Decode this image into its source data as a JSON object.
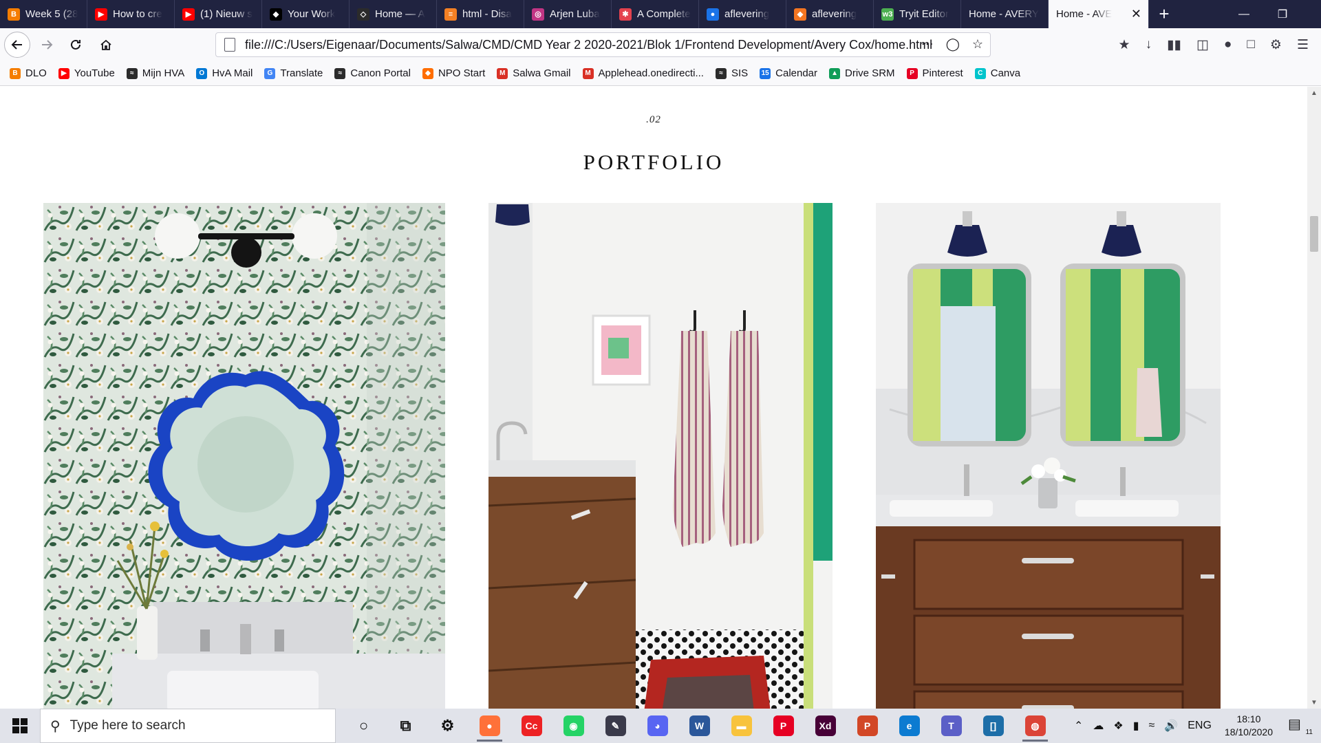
{
  "browser": {
    "tabs": [
      {
        "label": "Week 5 (28",
        "icon": "blogger-icon",
        "color": "#f57d00",
        "glyph": "B"
      },
      {
        "label": "How to cre",
        "icon": "youtube-icon",
        "color": "#ff0000",
        "glyph": "▶"
      },
      {
        "label": "(1) Nieuw s",
        "icon": "youtube-icon",
        "color": "#ff0000",
        "glyph": "▶"
      },
      {
        "label": "Your Work",
        "icon": "codepen-icon",
        "color": "#000000",
        "glyph": "◆"
      },
      {
        "label": "Home — A",
        "icon": "codepen-icon",
        "color": "#2b2b2b",
        "glyph": "◇"
      },
      {
        "label": "html - Disa",
        "icon": "stackoverflow-icon",
        "color": "#f48024",
        "glyph": "≡"
      },
      {
        "label": "Arjen Luba",
        "icon": "instagram-icon",
        "color": "#c13584",
        "glyph": "◎"
      },
      {
        "label": "A Complete",
        "icon": "css-tricks-icon",
        "color": "#e4424e",
        "glyph": "✱"
      },
      {
        "label": "aflevering",
        "icon": "video-icon",
        "color": "#1a73e8",
        "glyph": "●"
      },
      {
        "label": "aflevering",
        "icon": "crunchyroll-icon",
        "color": "#f47521",
        "glyph": "◆"
      },
      {
        "label": "Tryit Editor",
        "icon": "w3schools-icon",
        "color": "#4caf50",
        "glyph": "w3"
      },
      {
        "label": "Home - AVERY",
        "icon": "",
        "color": "",
        "glyph": ""
      }
    ],
    "active_tab": {
      "label": "Home - AVE"
    },
    "new_tab": "+",
    "url": "file:///C:/Users/Eigenaar/Documents/Salwa/CMD/CMD Year 2 2020-2021/Blok 1/Frontend Development/Avery Cox/home.html",
    "bookmarks": [
      {
        "label": "DLO",
        "color": "#f57d00",
        "glyph": "B"
      },
      {
        "label": "YouTube",
        "color": "#ff0000",
        "glyph": "▶"
      },
      {
        "label": "Mijn HVA",
        "color": "#2b2b2b",
        "glyph": "≈"
      },
      {
        "label": "HvA Mail",
        "color": "#0078d4",
        "glyph": "O"
      },
      {
        "label": "Translate",
        "color": "#4285f4",
        "glyph": "G"
      },
      {
        "label": "Canon Portal",
        "color": "#2b2b2b",
        "glyph": "≈"
      },
      {
        "label": "NPO Start",
        "color": "#ff6d00",
        "glyph": "◆"
      },
      {
        "label": "Salwa Gmail",
        "color": "#d93025",
        "glyph": "M"
      },
      {
        "label": "Applehead.onedirecti...",
        "color": "#d93025",
        "glyph": "M"
      },
      {
        "label": "SIS",
        "color": "#2b2b2b",
        "glyph": "≈"
      },
      {
        "label": "Calendar",
        "color": "#1a73e8",
        "glyph": "15"
      },
      {
        "label": "Drive SRM",
        "color": "#0f9d58",
        "glyph": "▲"
      },
      {
        "label": "Pinterest",
        "color": "#e60023",
        "glyph": "P"
      },
      {
        "label": "Canva",
        "color": "#00c4cc",
        "glyph": "C"
      }
    ]
  },
  "page": {
    "section_number": ".02",
    "section_title": "PORTFOLIO"
  },
  "taskbar": {
    "search_placeholder": "Type here to search",
    "apps": [
      {
        "name": "cortana-icon",
        "color": "transparent",
        "glyph": "○",
        "running": false
      },
      {
        "name": "task-view-icon",
        "color": "transparent",
        "glyph": "⧉",
        "running": false
      },
      {
        "name": "settings-icon",
        "color": "transparent",
        "glyph": "⚙",
        "running": false
      },
      {
        "name": "firefox-icon",
        "color": "#ff7139",
        "glyph": "●",
        "running": true
      },
      {
        "name": "creative-cloud-icon",
        "color": "#ed2224",
        "glyph": "Cc",
        "running": false
      },
      {
        "name": "whatsapp-icon",
        "color": "#25d366",
        "glyph": "◉",
        "running": false
      },
      {
        "name": "pen-app-icon",
        "color": "#3a3a4a",
        "glyph": "✎",
        "running": false
      },
      {
        "name": "discord-icon",
        "color": "#5865f2",
        "glyph": "◕",
        "running": false
      },
      {
        "name": "word-icon",
        "color": "#2b579a",
        "glyph": "W",
        "running": false
      },
      {
        "name": "file-explorer-icon",
        "color": "#f8c33c",
        "glyph": "▬",
        "running": false
      },
      {
        "name": "pinterest-icon",
        "color": "#e60023",
        "glyph": "P",
        "running": false
      },
      {
        "name": "adobe-xd-icon",
        "color": "#470137",
        "glyph": "Xd",
        "running": false
      },
      {
        "name": "powerpoint-icon",
        "color": "#d24726",
        "glyph": "P",
        "running": false
      },
      {
        "name": "edge-icon",
        "color": "#0c7bd1",
        "glyph": "e",
        "running": false
      },
      {
        "name": "teams-icon",
        "color": "#5b5fc7",
        "glyph": "T",
        "running": false
      },
      {
        "name": "brackets-icon",
        "color": "#1d6ea8",
        "glyph": "[]",
        "running": false
      },
      {
        "name": "chrome-icon",
        "color": "#db4437",
        "glyph": "◍",
        "running": true
      }
    ],
    "language": "ENG",
    "time": "18:10",
    "date": "18/10/2020",
    "notification_count": "11"
  }
}
